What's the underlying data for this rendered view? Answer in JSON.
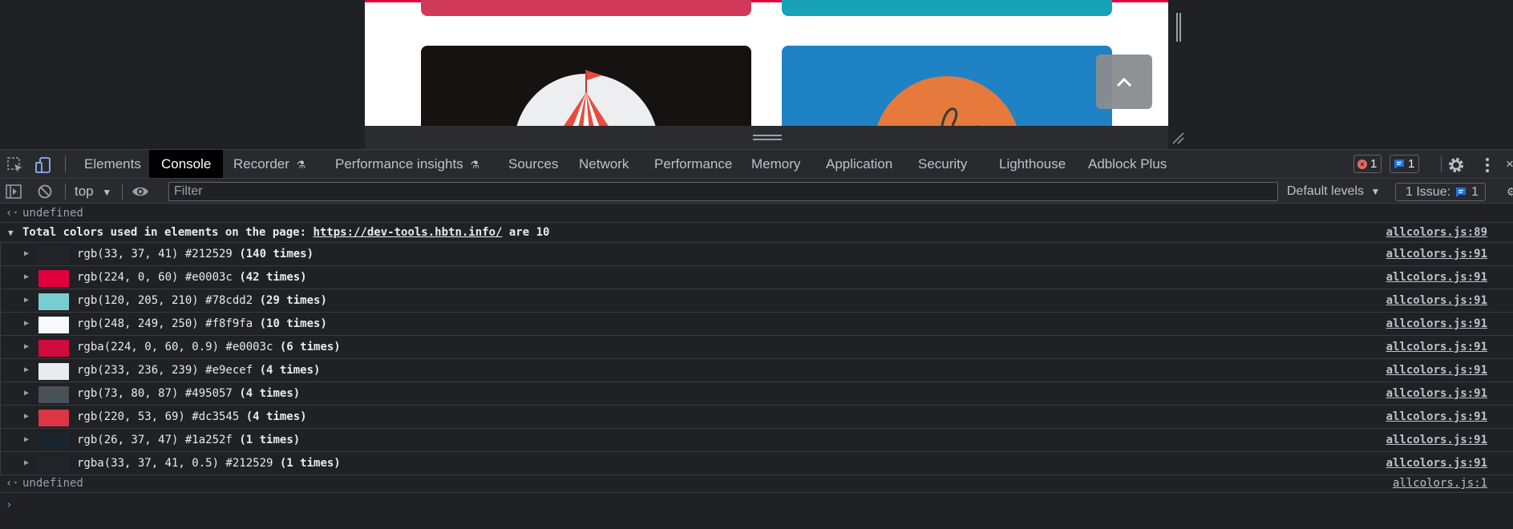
{
  "viewport": {
    "colors": {
      "topbar": "#e0003c",
      "card_red": "#d0395a",
      "card_teal": "#17a2b8",
      "card_dark": "#161212",
      "card_blue": "#1e82c4",
      "scroll_button": "#8a8d90"
    },
    "icons": [
      "circus-tent-icon",
      "basketball-icon",
      "chevron-up-icon"
    ]
  },
  "devtools": {
    "tabs": [
      {
        "label": "Elements",
        "active": false
      },
      {
        "label": "Console",
        "active": true
      },
      {
        "label": "Recorder",
        "active": false,
        "icon": "flask-icon"
      },
      {
        "label": "Performance insights",
        "active": false,
        "icon": "flask-icon"
      },
      {
        "label": "Sources",
        "active": false
      },
      {
        "label": "Network",
        "active": false
      },
      {
        "label": "Performance",
        "active": false
      },
      {
        "label": "Memory",
        "active": false
      },
      {
        "label": "Application",
        "active": false
      },
      {
        "label": "Security",
        "active": false
      },
      {
        "label": "Lighthouse",
        "active": false
      },
      {
        "label": "Adblock Plus",
        "active": false
      }
    ],
    "error_count": "1",
    "message_count": "1",
    "toolbar": {
      "context": "top",
      "filter_placeholder": "Filter",
      "levels": "Default levels",
      "issues_label": "1 Issue:",
      "issues_count": "1"
    }
  },
  "console": {
    "result_top": "undefined",
    "group": {
      "prefix": "Total colors used in elements on the page: ",
      "url": "https://dev-tools.hbtn.info/",
      "suffix": " are 10",
      "source": "allcolors.js:89"
    },
    "colors": [
      {
        "value": "rgb(33, 37, 41) #212529",
        "times": "(140 times)",
        "swatch": "#212529",
        "source": "allcolors.js:91"
      },
      {
        "value": "rgb(224, 0, 60) #e0003c",
        "times": "(42 times)",
        "swatch": "#e0003c",
        "source": "allcolors.js:91"
      },
      {
        "value": "rgb(120, 205, 210) #78cdd2",
        "times": "(29 times)",
        "swatch": "#78cdd2",
        "source": "allcolors.js:91"
      },
      {
        "value": "rgb(248, 249, 250) #f8f9fa",
        "times": "(10 times)",
        "swatch": "#f8f9fa",
        "source": "allcolors.js:91"
      },
      {
        "value": "rgba(224, 0, 60, 0.9) #e0003c",
        "times": "(6 times)",
        "swatch": "#d00a3c",
        "source": "allcolors.js:91"
      },
      {
        "value": "rgb(233, 236, 239) #e9ecef",
        "times": "(4 times)",
        "swatch": "#e9ecef",
        "source": "allcolors.js:91"
      },
      {
        "value": "rgb(73, 80, 87) #495057",
        "times": "(4 times)",
        "swatch": "#495057",
        "source": "allcolors.js:91"
      },
      {
        "value": "rgb(220, 53, 69) #dc3545",
        "times": "(4 times)",
        "swatch": "#dc3545",
        "source": "allcolors.js:91"
      },
      {
        "value": "rgb(26, 37, 47) #1a252f",
        "times": "(1 times)",
        "swatch": "#1a252f",
        "source": "allcolors.js:91"
      },
      {
        "value": "rgba(33, 37, 41, 0.5) #212529",
        "times": "(1 times)",
        "swatch": "#212529",
        "source": "allcolors.js:91"
      }
    ],
    "result_bottom": "undefined",
    "result_bottom_source": "allcolors.js:1"
  }
}
